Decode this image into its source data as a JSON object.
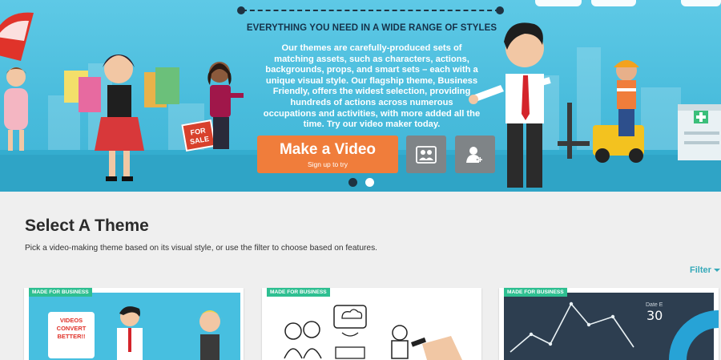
{
  "hero": {
    "heading": "EVERYTHING YOU NEED IN A WIDE RANGE OF STYLES",
    "body": "Our themes are carefully-produced sets of matching assets, such as characters, actions, backgrounds, props, and smart sets – each with a unique visual style. Our flagship theme, Business Friendly, offers the widest selection, providing hundreds of actions across numerous occupations and activities, with more added all the time. Try our video maker today.",
    "cta_main": "Make a Video",
    "cta_sub": "Sign up to try",
    "sale_sign": "FOR SALE",
    "carousel": {
      "count": 2,
      "active": 0
    },
    "colors": {
      "cta": "#f07d3b",
      "sky": "#4fc1e0",
      "dot_active": "#1f3342"
    }
  },
  "icons": {
    "characters_button": "people-icon",
    "add_user_button": "add-user-icon"
  },
  "main": {
    "title": "Select A Theme",
    "description": "Pick a video-making theme based on its visual style, or use the filter to choose based on features.",
    "filter_label": "Filter"
  },
  "cards": [
    {
      "badge": "MADE FOR BUSINESS",
      "speech": "VIDEOS CONVERT BETTER!!"
    },
    {
      "badge": "MADE FOR BUSINESS"
    },
    {
      "badge": "MADE FOR BUSINESS",
      "chart_label": "Date E",
      "chart_value": "30"
    }
  ],
  "colors": {
    "badge": "#2ebf91",
    "filter": "#36a9b9",
    "accent_red": "#e0332a"
  }
}
